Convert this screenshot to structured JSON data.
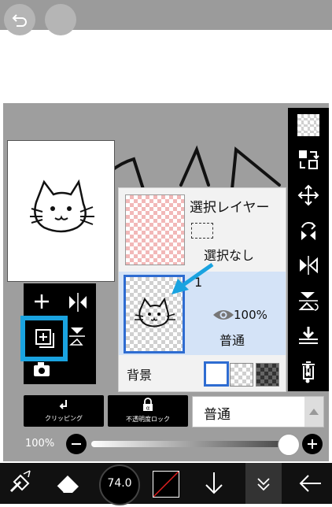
{
  "layer_panel": {
    "selection_layer_title": "選択レイヤー",
    "selection_status": "選択なし",
    "layer1_name": "1",
    "layer1_opacity": "100%",
    "layer1_blend": "普通",
    "background_label": "背景"
  },
  "controls": {
    "clipping_label": "クリッピング",
    "opacity_lock_label": "不透明度ロック",
    "blend_mode_value": "普通",
    "opacity_value_label": "100%",
    "opacity_fraction": 1.0
  },
  "bottom_toolbar": {
    "brush_size": "74.0"
  },
  "colors": {
    "highlight_blue": "#1aa3e0",
    "selected_layer_bg": "#d4e3f7",
    "selected_border": "#2e6cd1"
  },
  "icons": {
    "top": [
      "undo-icon",
      "redo-icon"
    ],
    "right_toolbar": [
      "transparency-checker-icon",
      "layer-transfer-icon",
      "move-icon",
      "rotate-icon",
      "flip-horizontal-icon",
      "flip-vertical-icon",
      "merge-down-icon",
      "trash-icon",
      "more-icon"
    ],
    "left_grid": [
      "add-layer-icon",
      "flip-horizontal-small-icon",
      "duplicate-layer-icon",
      "flip-vertical-small-icon",
      "camera-icon"
    ],
    "bottom": [
      "transform-icon",
      "eraser-icon",
      "brush-size-icon",
      "color-swatch-icon",
      "arrow-down-icon",
      "collapse-icon",
      "back-icon"
    ]
  }
}
